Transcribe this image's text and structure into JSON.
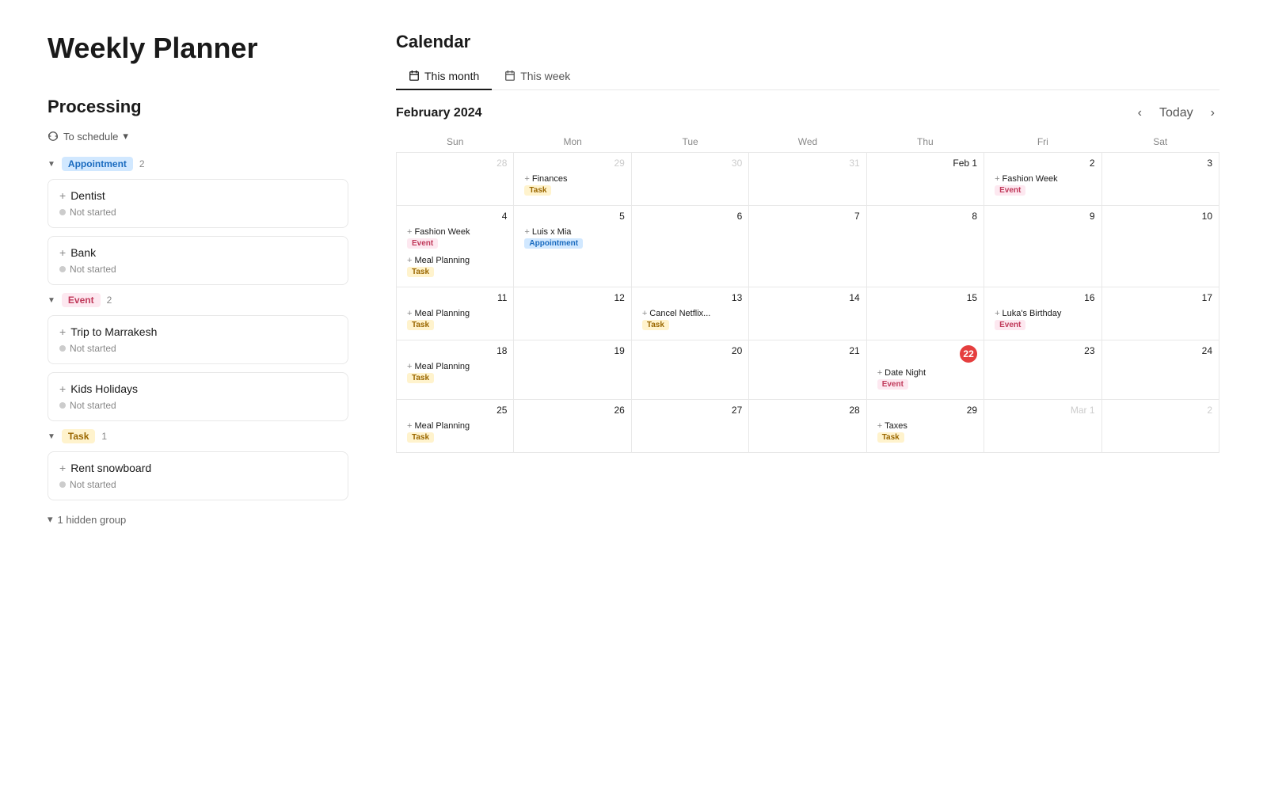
{
  "page": {
    "title": "Weekly Planner"
  },
  "left": {
    "section_title": "Processing",
    "schedule_toggle": "To schedule",
    "groups": [
      {
        "id": "appointment",
        "label": "Appointment",
        "badge_class": "badge-appointment",
        "count": 2,
        "items": [
          {
            "title": "Dentist",
            "status": "Not started"
          },
          {
            "title": "Bank",
            "status": "Not started"
          }
        ]
      },
      {
        "id": "event",
        "label": "Event",
        "badge_class": "badge-event",
        "count": 2,
        "items": [
          {
            "title": "Trip to Marrakesh",
            "status": "Not started"
          },
          {
            "title": "Kids Holidays",
            "status": "Not started"
          }
        ]
      },
      {
        "id": "task",
        "label": "Task",
        "badge_class": "badge-task",
        "count": 1,
        "items": [
          {
            "title": "Rent snowboard",
            "status": "Not started"
          }
        ]
      }
    ],
    "hidden_group": "1 hidden group"
  },
  "calendar": {
    "title": "Calendar",
    "tabs": [
      {
        "label": "This month",
        "active": true
      },
      {
        "label": "This week",
        "active": false
      }
    ],
    "month": "February 2024",
    "nav": {
      "today_label": "Today"
    },
    "days": [
      "Sun",
      "Mon",
      "Tue",
      "Wed",
      "Thu",
      "Fri",
      "Sat"
    ],
    "weeks": [
      [
        {
          "date": "28",
          "month": "other",
          "events": []
        },
        {
          "date": "29",
          "month": "other",
          "events": [
            {
              "title": "Finances",
              "tag": "Task",
              "tag_class": "tag-task"
            }
          ]
        },
        {
          "date": "30",
          "month": "other",
          "events": []
        },
        {
          "date": "31",
          "month": "other",
          "events": []
        },
        {
          "date": "Feb 1",
          "month": "current",
          "events": []
        },
        {
          "date": "2",
          "month": "current",
          "events": [
            {
              "title": "Fashion Week",
              "tag": "Event",
              "tag_class": "tag-event"
            }
          ]
        },
        {
          "date": "3",
          "month": "current",
          "events": []
        }
      ],
      [
        {
          "date": "4",
          "month": "current",
          "events": [
            {
              "title": "Fashion Week",
              "tag": "Event",
              "tag_class": "tag-event"
            },
            {
              "title": "Meal Planning",
              "tag": "Task",
              "tag_class": "tag-task"
            }
          ]
        },
        {
          "date": "5",
          "month": "current",
          "events": [
            {
              "title": "Luis x Mia",
              "tag": "Appointment",
              "tag_class": "tag-appointment"
            }
          ]
        },
        {
          "date": "6",
          "month": "current",
          "events": []
        },
        {
          "date": "7",
          "month": "current",
          "events": []
        },
        {
          "date": "8",
          "month": "current",
          "events": []
        },
        {
          "date": "9",
          "month": "current",
          "events": []
        },
        {
          "date": "10",
          "month": "current",
          "events": []
        }
      ],
      [
        {
          "date": "11",
          "month": "current",
          "events": [
            {
              "title": "Meal Planning",
              "tag": "Task",
              "tag_class": "tag-task"
            }
          ]
        },
        {
          "date": "12",
          "month": "current",
          "events": []
        },
        {
          "date": "13",
          "month": "current",
          "events": [
            {
              "title": "Cancel Netflix...",
              "tag": "Task",
              "tag_class": "tag-task"
            }
          ]
        },
        {
          "date": "14",
          "month": "current",
          "events": []
        },
        {
          "date": "15",
          "month": "current",
          "events": []
        },
        {
          "date": "16",
          "month": "current",
          "events": [
            {
              "title": "Luka's Birthday",
              "tag": "Event",
              "tag_class": "tag-event"
            }
          ]
        },
        {
          "date": "17",
          "month": "current",
          "events": []
        }
      ],
      [
        {
          "date": "18",
          "month": "current",
          "events": [
            {
              "title": "Meal Planning",
              "tag": "Task",
              "tag_class": "tag-task"
            }
          ]
        },
        {
          "date": "19",
          "month": "current",
          "events": []
        },
        {
          "date": "20",
          "month": "current",
          "events": []
        },
        {
          "date": "21",
          "month": "current",
          "events": []
        },
        {
          "date": "22",
          "month": "current",
          "today": true,
          "events": [
            {
              "title": "Date Night",
              "tag": "Event",
              "tag_class": "tag-event"
            }
          ]
        },
        {
          "date": "23",
          "month": "current",
          "events": []
        },
        {
          "date": "24",
          "month": "current",
          "events": []
        }
      ],
      [
        {
          "date": "25",
          "month": "current",
          "events": [
            {
              "title": "Meal Planning",
              "tag": "Task",
              "tag_class": "tag-task"
            }
          ]
        },
        {
          "date": "26",
          "month": "current",
          "events": []
        },
        {
          "date": "27",
          "month": "current",
          "events": []
        },
        {
          "date": "28",
          "month": "current",
          "events": []
        },
        {
          "date": "29",
          "month": "current",
          "events": [
            {
              "title": "Taxes",
              "tag": "Task",
              "tag_class": "tag-task"
            }
          ]
        },
        {
          "date": "Mar 1",
          "month": "other",
          "events": []
        },
        {
          "date": "2",
          "month": "other",
          "events": []
        }
      ]
    ]
  }
}
